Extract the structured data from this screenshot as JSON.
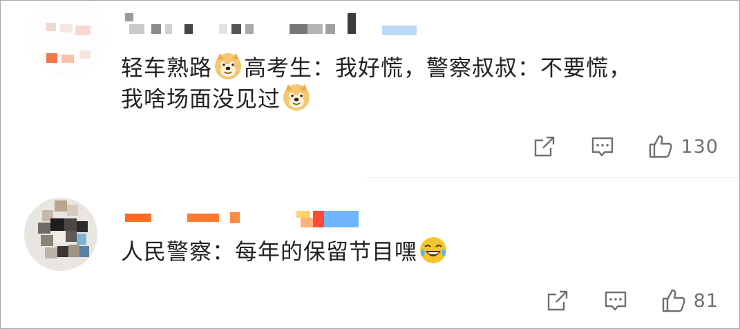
{
  "comments": [
    {
      "text_a": "轻车熟路",
      "text_b": "高考生：我好慌，警察叔叔：不要慌，",
      "text_c": "我啥场面没见过",
      "emoji_a": "doge-emoji",
      "emoji_b": "doge-emoji",
      "like_count": "130",
      "share_icon": "share-icon",
      "reply_icon": "comment-icon",
      "like_icon": "thumbs-up-icon"
    },
    {
      "text_a": "人民警察：每年的保留节目嘿",
      "emoji_a": "laugh-cry-emoji",
      "like_count": "81",
      "share_icon": "share-icon",
      "reply_icon": "comment-icon",
      "like_icon": "thumbs-up-icon"
    }
  ],
  "colors": {
    "text": "#222222",
    "action_gray": "#6f6f6f",
    "name_orange": "#ff7a2e",
    "name_blue": "#6fb6ff"
  }
}
